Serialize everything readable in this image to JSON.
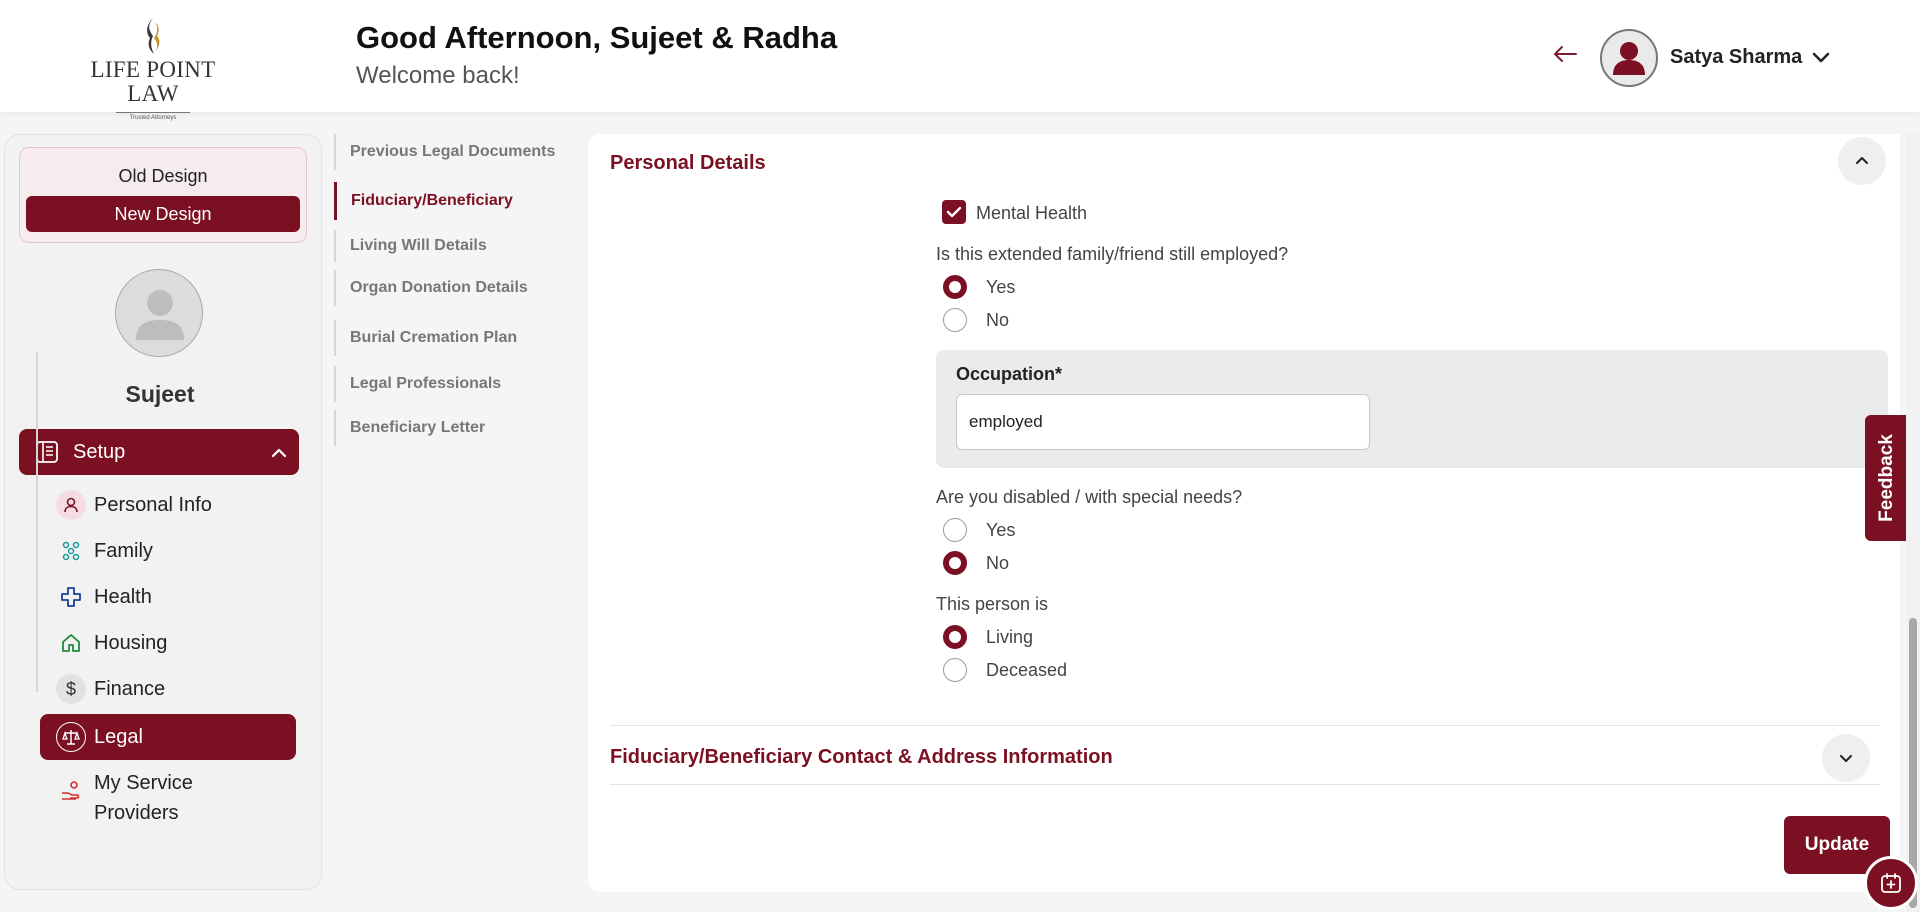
{
  "header": {
    "logo_name": "LIFE POINT LAW",
    "logo_tagline": "Trusted Attorneys",
    "greeting": "Good Afternoon, Sujeet & Radha",
    "subtitle": "Welcome back!",
    "user_name": "Satya Sharma"
  },
  "sidebar": {
    "old_design": "Old Design",
    "new_design": "New Design",
    "profile_name": "Sujeet",
    "setup_label": "Setup",
    "items": [
      {
        "label": "Personal Info",
        "icon": "person-icon"
      },
      {
        "label": "Family",
        "icon": "family-icon"
      },
      {
        "label": "Health",
        "icon": "health-cross-icon"
      },
      {
        "label": "Housing",
        "icon": "home-icon"
      },
      {
        "label": "Finance",
        "icon": "dollar-icon"
      },
      {
        "label": "Legal",
        "icon": "scales-icon",
        "active": true
      },
      {
        "label": "My Service Providers",
        "icon": "service-provider-icon"
      }
    ]
  },
  "submenu": {
    "items": [
      {
        "label": "Previous Legal Documents"
      },
      {
        "label": "Fiduciary/Beneficiary",
        "active": true
      },
      {
        "label": "Living Will Details"
      },
      {
        "label": "Organ Donation Details"
      },
      {
        "label": "Burial Cremation Plan"
      },
      {
        "label": "Legal Professionals"
      },
      {
        "label": "Beneficiary Letter"
      }
    ]
  },
  "main": {
    "section_title": "Personal Details",
    "mental_health_label": "Mental Health",
    "mental_health_checked": true,
    "employed_question": "Is this extended family/friend still employed?",
    "employed_options": [
      "Yes",
      "No"
    ],
    "employed_selected": "Yes",
    "occupation_label": "Occupation*",
    "occupation_value": "employed",
    "disabled_question": "Are you disabled / with special needs?",
    "disabled_options": [
      "Yes",
      "No"
    ],
    "disabled_selected": "No",
    "person_question": "This person is",
    "person_options": [
      "Living",
      "Deceased"
    ],
    "person_selected": "Living",
    "contact_section_title": "Fiduciary/Beneficiary Contact & Address Information",
    "update_label": "Update",
    "feedback_label": "Feedback"
  },
  "colors": {
    "brand": "#7b1023",
    "background": "#f5f5f5"
  }
}
